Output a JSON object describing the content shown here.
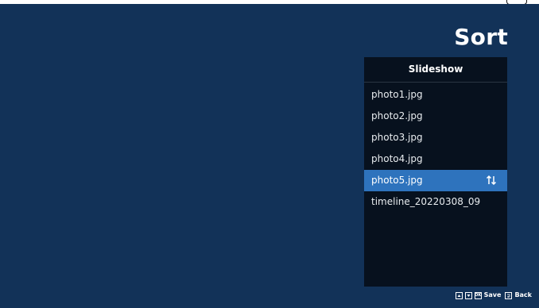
{
  "screen": {
    "title": "Sort"
  },
  "panel": {
    "header": "Slideshow",
    "items": [
      {
        "label": "photo1.jpg",
        "selected": false
      },
      {
        "label": "photo2.jpg",
        "selected": false
      },
      {
        "label": "photo3.jpg",
        "selected": false
      },
      {
        "label": "photo4.jpg",
        "selected": false
      },
      {
        "label": "photo5.jpg",
        "selected": true,
        "icon": "sort-arrows-icon"
      },
      {
        "label": "timeline_20220308_09",
        "selected": false
      }
    ]
  },
  "footer": {
    "up_icon": "up-key-icon",
    "down_icon": "down-key-icon",
    "ok_key": "OK",
    "save_label": "Save",
    "back_icon": "back-key-icon",
    "back_label": "Back"
  },
  "colors": {
    "background": "#123258",
    "panel": "#07111e",
    "selected": "#2e73bd",
    "text": "#ffffff"
  }
}
